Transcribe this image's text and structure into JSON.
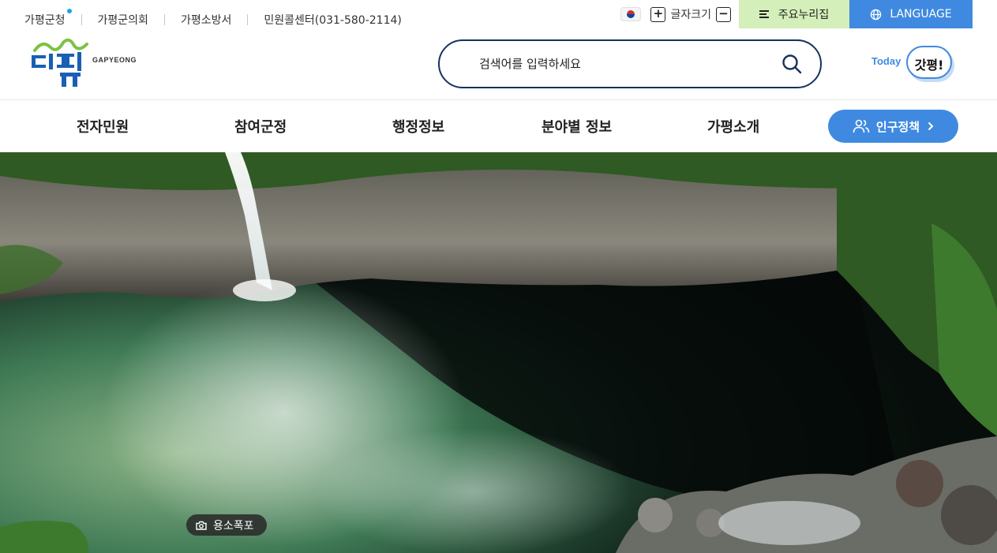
{
  "utility": {
    "links": [
      "가평군청",
      "가평군의회",
      "가평소방서",
      "민원콜센터(031-580-2114)"
    ],
    "font_size_label": "글자크기",
    "font_size_plus": "+",
    "font_size_minus": "−",
    "services_label": "주요누리집",
    "language_label": "LANGUAGE"
  },
  "header": {
    "logo_text": "GAPYEONG",
    "search_placeholder": "검색어를 입력하세요",
    "today_label": "Today",
    "today_title": "갓평!"
  },
  "nav": {
    "items": [
      "전자민원",
      "참여군정",
      "행정정보",
      "분야별 정보",
      "가평소개"
    ],
    "cta_label": "인구정책"
  },
  "hero": {
    "caption": "용소폭포"
  },
  "colors": {
    "accent_blue": "#3f8ae0",
    "services_green": "#d4efb9",
    "search_border": "#16325c"
  }
}
